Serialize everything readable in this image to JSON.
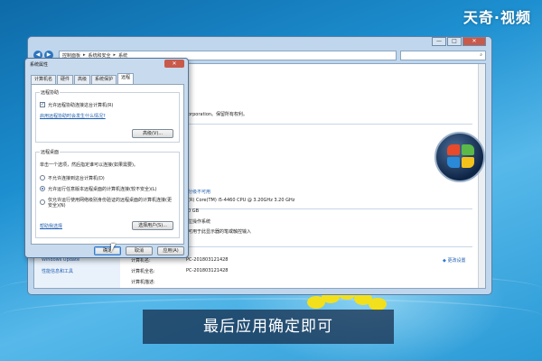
{
  "watermark": "天奇·视频",
  "caption": "最后应用确定即可",
  "main_window": {
    "breadcrumb": [
      "控制面板",
      "系统和安全",
      "系统"
    ],
    "nav_back": "◀",
    "nav_forward": "▶",
    "right_texts": {
      "corporation": "orporation。保留所有权利。",
      "windows_activation": "分级不可用",
      "processor": "(R) Core(TM) i5-4460  CPU @ 3.20GHz   3.20 GHz",
      "memory": "0 GB",
      "system_type": "位操作系统",
      "pen_touch": "可用于此显示器的笔或触控输入",
      "change_settings": "更改设置"
    },
    "left_links": [
      "Windows Update",
      "性能信息和工具"
    ],
    "bottom_rows": [
      {
        "label": "计算机名:",
        "value": "PC-201803121428"
      },
      {
        "label": "计算机全名:",
        "value": "PC-201803121428"
      },
      {
        "label": "计算机描述:",
        "value": ""
      }
    ],
    "window_buttons": [
      "—",
      "□",
      "✕"
    ]
  },
  "dialog": {
    "title": "系统属性",
    "close": "✕",
    "tabs": [
      "计算机名",
      "硬件",
      "高级",
      "系统保护",
      "远程"
    ],
    "active_tab": 4,
    "remote_assist": {
      "group_label": "远程协助",
      "checkbox_label": "允许远程协助连接这台计算机(R)",
      "checked": true,
      "link": "启用远程协助时会发生什么情况?",
      "advanced_button": "高级(V)..."
    },
    "remote_desktop": {
      "group_label": "远程桌面",
      "instruction": "单击一个选项，然后指定谁可以连接(如果需要)。",
      "options": [
        "不允许连接到这台计算机(D)",
        "允许运行任意版本远程桌面的计算机连接(较不安全)(L)",
        "仅允许运行使用网络级别身份验证的远程桌面的计算机连接(更安全)(N)"
      ],
      "selected": 1,
      "help_link": "帮助我选择",
      "select_users_button": "选择用户(S)..."
    },
    "buttons": {
      "ok": "确定",
      "cancel": "取消",
      "apply": "应用(A)"
    }
  }
}
